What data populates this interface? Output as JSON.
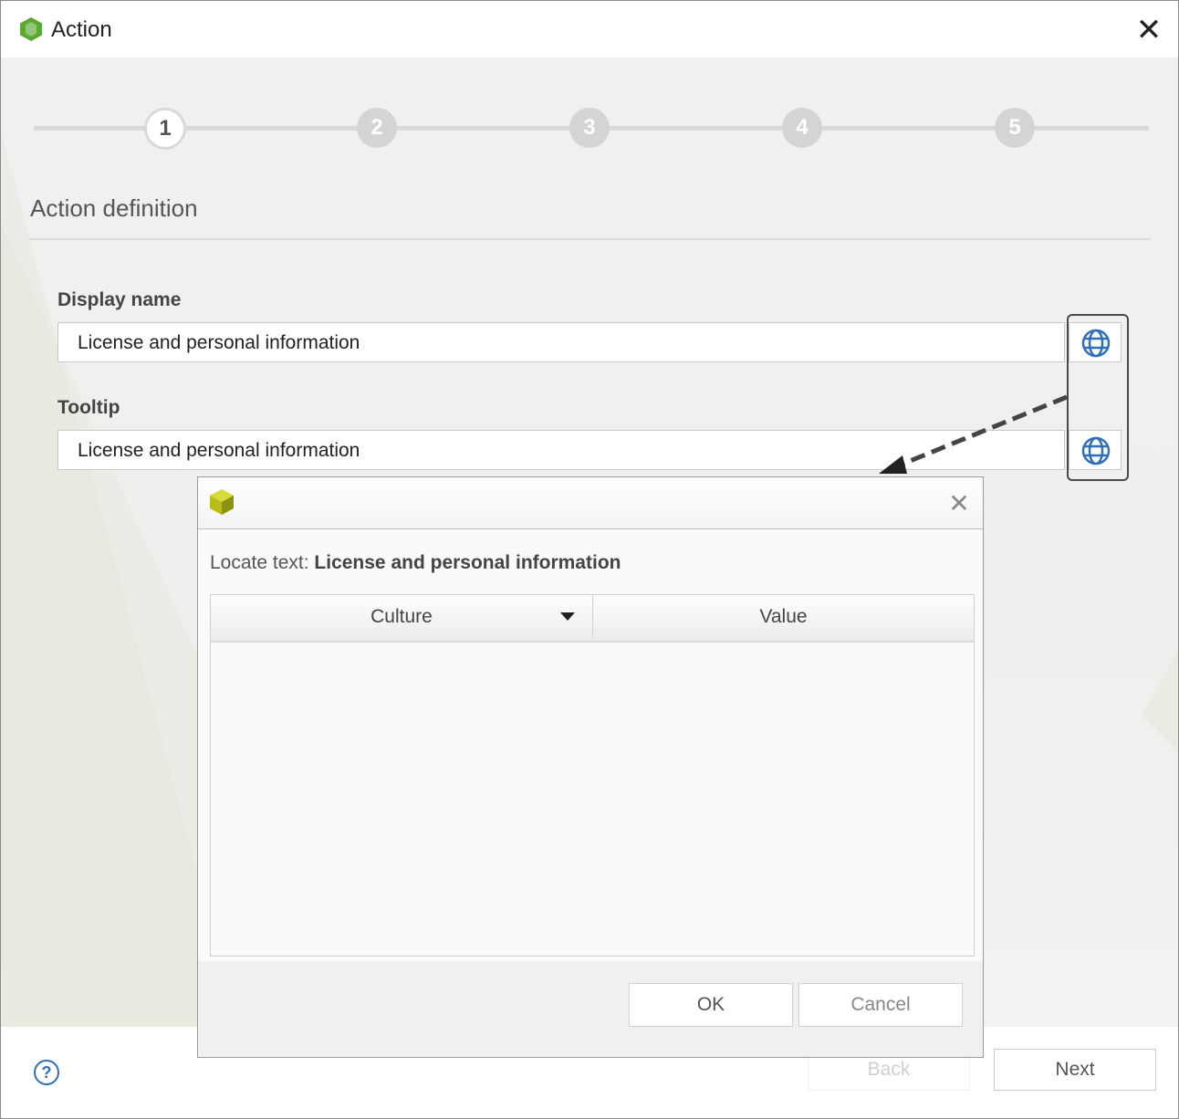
{
  "window": {
    "title": "Action",
    "close_glyph": "✕",
    "app_icon": "app-logo-icon"
  },
  "stepper": {
    "steps": [
      "1",
      "2",
      "3",
      "4",
      "5"
    ],
    "active_step": 1
  },
  "section": {
    "title": "Action definition"
  },
  "fields": {
    "display_name": {
      "label": "Display name",
      "value": "License and personal information",
      "icon": "globe-icon"
    },
    "tooltip": {
      "label": "Tooltip",
      "value": "License and personal information",
      "icon": "globe-icon"
    }
  },
  "footer": {
    "help_glyph": "?",
    "back_label": "Back",
    "next_label": "Next"
  },
  "dialog": {
    "icon": "cube-logo-icon",
    "close_glyph": "✕",
    "locate_prefix": "Locate text: ",
    "locate_value": "License and personal information",
    "columns": [
      "Culture",
      "Value"
    ],
    "rows": [],
    "ok_label": "OK",
    "cancel_label": "Cancel"
  },
  "colors": {
    "accent_blue": "#2f6fb9",
    "brand_green": "#5aa832",
    "brand_yellow": "#b8bd1a"
  }
}
